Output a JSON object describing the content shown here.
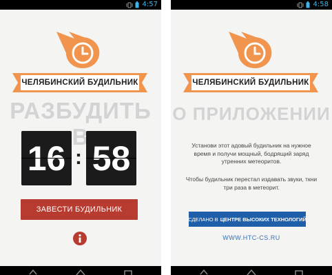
{
  "colors": {
    "accent_orange": "#f0944e",
    "set_button": "#b83b30",
    "link_blue": "#1f5ea8",
    "status_clock": "#40b4ea",
    "title_gray": "#d3d3d3"
  },
  "icons": {
    "logo": "meteor-clock-icon",
    "info": "info-icon",
    "status": [
      "vibrate-icon",
      "battery-icon"
    ],
    "nav": [
      "back-icon",
      "home-icon",
      "recents-icon"
    ]
  },
  "left_screen": {
    "status_time": "4:57",
    "app_name": "ЧЕЛЯБИНСКИЙ БУДИЛЬНИК",
    "heading": "РАЗБУДИТЬ В",
    "hours": "16",
    "separator": ":",
    "minutes": "58",
    "set_alarm_label": "ЗАВЕСТИ БУДИЛЬНИК"
  },
  "right_screen": {
    "status_time": "4:58",
    "app_name": "ЧЕЛЯБИНСКИЙ БУДИЛЬНИК",
    "heading": "О ПРИЛОЖЕНИИ",
    "paragraph1": "Установи этот адовый будильник на нужное время и получи мощный, бодрящий заряд утренних метеоритов.",
    "paragraph2": "Чтобы будильник перестал издавать звуки, ткни три раза в метеорит.",
    "made_prefix": "СДЕЛАНО В",
    "made_org": "ЦЕНТРЕ ВЫСОКИХ ТЕХНОЛОГИЙ",
    "url": "WWW.HTC-CS.RU"
  }
}
